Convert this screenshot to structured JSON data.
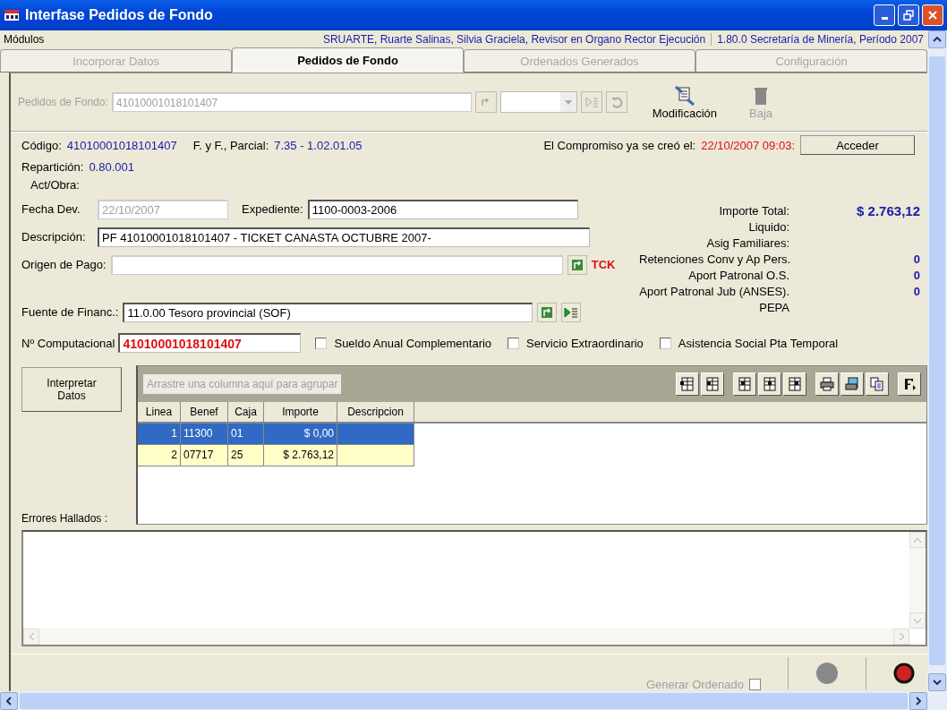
{
  "window": {
    "title": "Interfase Pedidos de Fondo"
  },
  "header": {
    "modules_label": "Módulos",
    "user": "SRUARTE, Ruarte Salinas, Silvia Graciela, Revisor en Organo Rector Ejecución",
    "version": "1.80.0 Secretaría de Minería, Período 2007"
  },
  "tabs": [
    {
      "label": "Incorporar Datos",
      "selected": false,
      "disabled": true
    },
    {
      "label": "Pedidos de Fondo",
      "selected": true,
      "disabled": false
    },
    {
      "label": "Ordenados Generados",
      "selected": false,
      "disabled": true
    },
    {
      "label": "Configuración",
      "selected": false,
      "disabled": true
    }
  ],
  "toolbar": {
    "pedidos_label": "Pedidos de Fondo:",
    "pedidos_value": "41010001018101407",
    "actions": [
      {
        "label": "Modificación",
        "disabled": false
      },
      {
        "label": "Baja",
        "disabled": true
      }
    ]
  },
  "info": {
    "codigo_label": "Código:",
    "codigo_value": "41010001018101407",
    "fyf_label": "F. y F., Parcial:",
    "fyf_value": "7.35 - 1.02.01.05",
    "compromiso_label": "El Compromiso ya se creó el:",
    "compromiso_value": "22/10/2007 09:03:",
    "acceder_button": "Acceder",
    "reparticion_label": "Repartición:",
    "reparticion_value": "0.80.001",
    "act_obra_label": "Act/Obra:"
  },
  "fields": {
    "fecha_label": "Fecha Dev.",
    "fecha_value": "22/10/2007",
    "expediente_label": "Expediente:",
    "expediente_value": "1100-0003-2006",
    "descripcion_label": "Descripción:",
    "descripcion_value": "PF 41010001018101407 - TICKET CANASTA OCTUBRE 2007-",
    "origen_label": "Origen de Pago:",
    "origen_tag": "TCK",
    "fuente_label": "Fuente de Financ.:",
    "fuente_value": "11.0.00 Tesoro provincial (SOF)",
    "computacional_label": "Nº Computacional",
    "computacional_value": "41010001018101407"
  },
  "totals": [
    {
      "label": "Importe Total:",
      "value": "$ 2.763,12"
    },
    {
      "label": "Liquido:"
    },
    {
      "label": "Asig Familiares:"
    },
    {
      "label": "Retenciones Conv y Ap Pers.",
      "value": "0"
    },
    {
      "label": "Aport Patronal O.S.",
      "value": "0"
    },
    {
      "label": "Aport Patronal Jub (ANSES).",
      "value": "0"
    },
    {
      "label": "PEPA"
    }
  ],
  "checkboxes": [
    {
      "label": "Sueldo Anual Complementario",
      "checked": false
    },
    {
      "label": "Servicio Extraordinario",
      "checked": false
    },
    {
      "label": "Asistencia Social Pta Temporal",
      "checked": false
    }
  ],
  "interpretar_button": "Interpretar Datos",
  "grid": {
    "group_placeholder": "Arrastre una columna aquí para agrupar",
    "columns": [
      "Linea",
      "Benef",
      "Caja",
      "Importe",
      "Descripcion"
    ],
    "rows": [
      {
        "selected": true,
        "cells": [
          "1",
          "11300",
          "01",
          "$ 0,00",
          ""
        ]
      },
      {
        "selected": false,
        "cells": [
          "2",
          "07717",
          "25",
          "$ 2.763,12",
          ""
        ]
      }
    ]
  },
  "errors_label": "Errores Hallados :",
  "footer": {
    "generar_label": "Generar Ordenado",
    "generar_checked": false
  }
}
